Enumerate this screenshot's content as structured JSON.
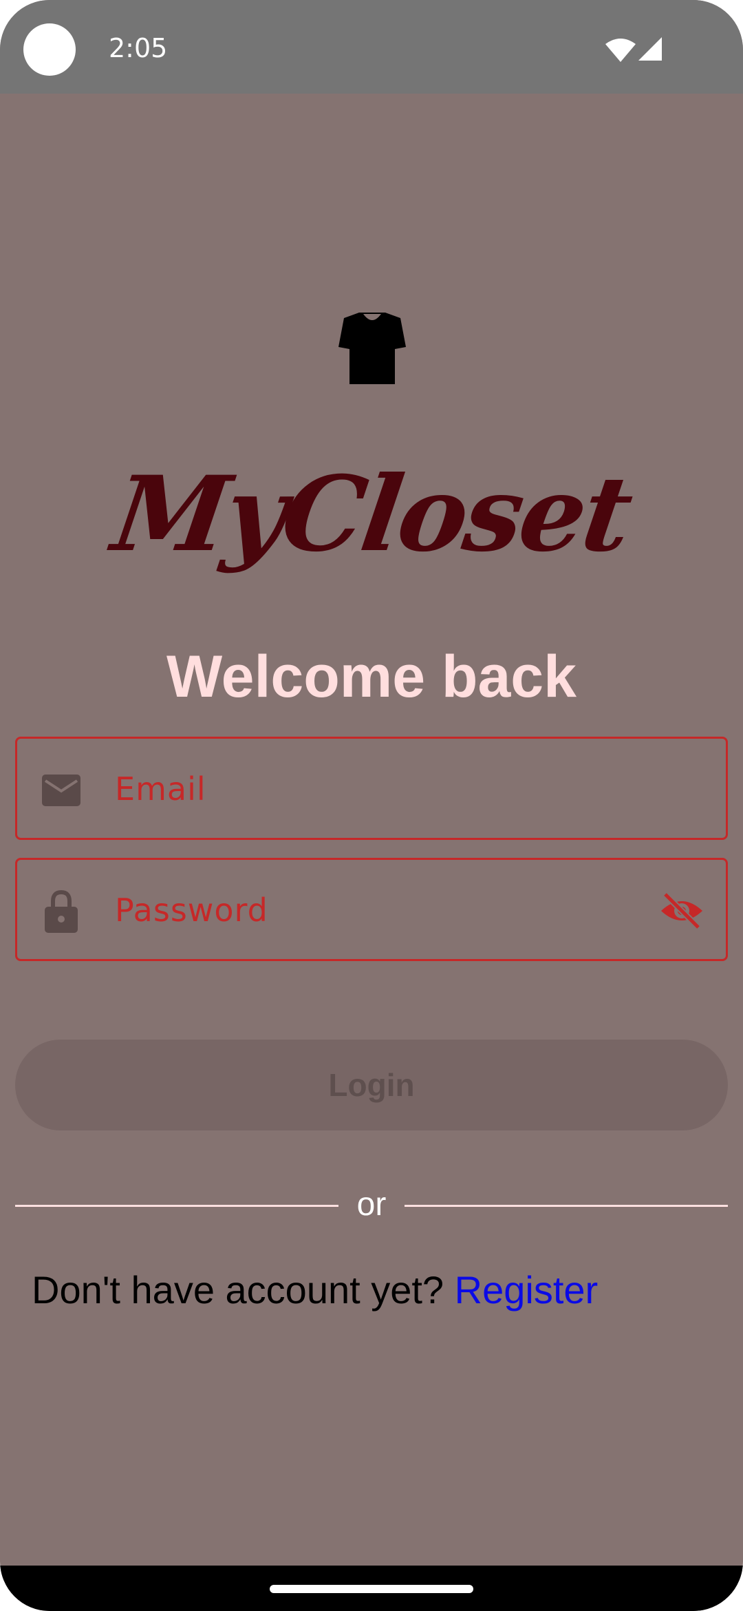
{
  "status_bar": {
    "time": "2:05"
  },
  "app": {
    "logo_text": "MyCloset",
    "welcome": "Welcome back"
  },
  "form": {
    "email": {
      "placeholder": "Email",
      "icon": "mail-icon"
    },
    "password": {
      "placeholder": "Password",
      "icon": "lock-icon",
      "toggle_icon": "eye-off-icon"
    },
    "login_label": "Login"
  },
  "divider": {
    "text": "or"
  },
  "register": {
    "prompt": "Don't have account yet? ",
    "link": "Register"
  },
  "colors": {
    "background": "#857371",
    "accent_error": "#c62828",
    "logo": "#4a050c",
    "welcome": "#ffdede",
    "link": "#0a0ae6",
    "button_disabled": "#786665"
  }
}
